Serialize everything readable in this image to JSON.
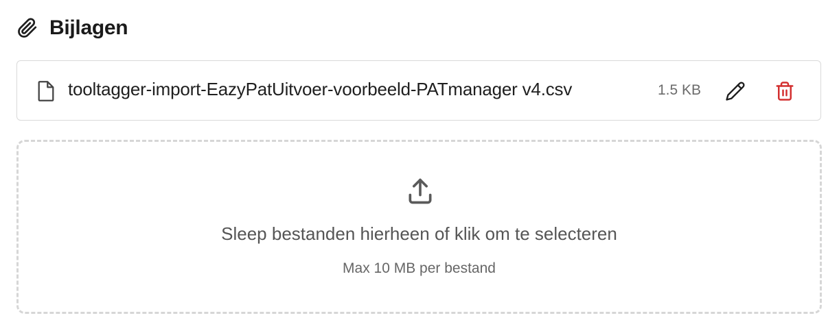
{
  "attachments": {
    "title": "Bijlagen",
    "header_icon": "paperclip-icon",
    "files": [
      {
        "name": "tooltagger-import-EazyPatUitvoer-voorbeeld-PATmanager v4.csv",
        "size": "1.5 KB",
        "file_icon": "file-icon",
        "edit_icon": "pencil-icon",
        "delete_icon": "trash-icon"
      }
    ],
    "dropzone": {
      "icon": "upload-icon",
      "text": "Sleep bestanden hierheen of klik om te selecteren",
      "subtext": "Max 10 MB per bestand"
    }
  },
  "colors": {
    "delete": "#d32f2f",
    "icon": "#1f1f1f",
    "muted_text": "#6b6b6b",
    "border": "#d9d9d9",
    "dashed_border": "#d6d6d6"
  }
}
